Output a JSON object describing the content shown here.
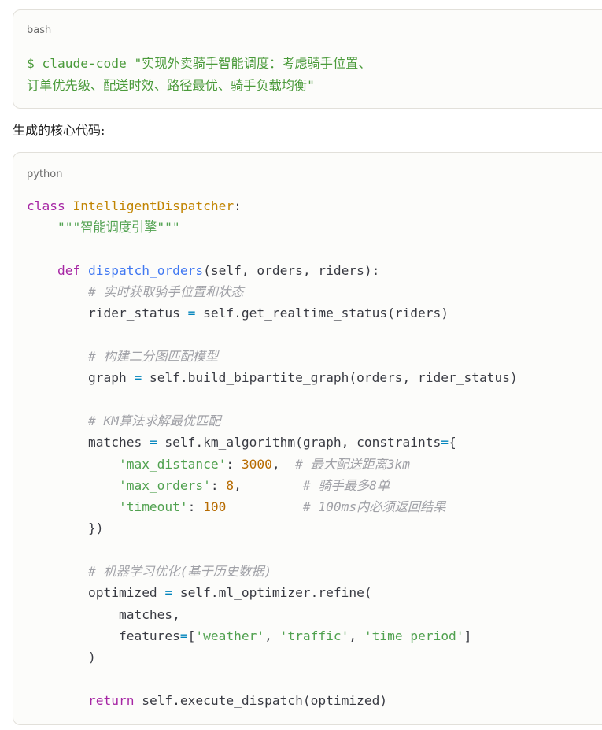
{
  "bash_block": {
    "language": "bash",
    "line1": "$ claude-code \"实现外卖骑手智能调度：考虑骑手位置、",
    "line2": "订单优先级、配送时效、路径最优、骑手负载均衡\""
  },
  "section_label": "生成的核心代码:",
  "python_block": {
    "language": "python",
    "t": {
      "kw_class": "class",
      "class_name": "IntelligentDispatcher",
      "colon": ":",
      "indent4": "    ",
      "indent8": "        ",
      "indent12": "            ",
      "docstring": "\"\"\"智能调度引擎\"\"\"",
      "kw_def": "def",
      "fn_name": "dispatch_orders",
      "def_args": "(self, orders, riders):",
      "cm1": "# 实时获取骑手位置和状态",
      "rs_var": "rider_status ",
      "eq": "=",
      "rs_call": " self.get_realtime_status(riders)",
      "cm2": "# 构建二分图匹配模型",
      "graph_var": "graph ",
      "graph_call": " self.build_bipartite_graph(orders, rider_status)",
      "cm3": "# KM算法求解最优匹配",
      "matches_var": "matches ",
      "matches_call": " self.km_algorithm(graph, constraints",
      "brace_open": "{",
      "k_maxdist": "'max_distance'",
      "colon_sp": ": ",
      "v_maxdist": "3000",
      "comma_pad1": ",  ",
      "cm_maxdist": "# 最大配送距离3km",
      "k_maxorders": "'max_orders'",
      "v_maxorders": "8",
      "comma_pad2": ",        ",
      "cm_maxorders": "# 骑手最多8单",
      "k_timeout": "'timeout'",
      "v_timeout": "100",
      "pad3": "          ",
      "cm_timeout": "# 100ms内必须返回结果",
      "brace_close": "})",
      "cm4": "# 机器学习优化(基于历史数据)",
      "opt_var": "optimized ",
      "opt_call": " self.ml_optimizer.refine(",
      "matches_arg": "matches,",
      "features_kw": "features",
      "lbracket": "[",
      "s_weather": "'weather'",
      "comma_sp": ", ",
      "s_traffic": "'traffic'",
      "s_time": "'time_period'",
      "rbracket": "]",
      "rparen": ")",
      "kw_return": "return",
      "ret_call": " self.execute_dispatch(optimized)"
    }
  }
}
